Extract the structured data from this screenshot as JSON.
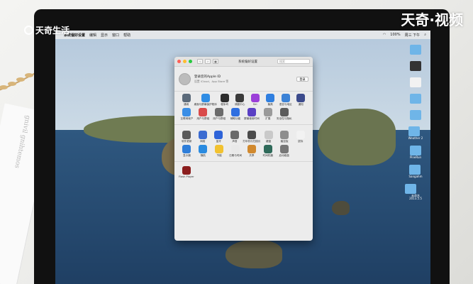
{
  "watermark": {
    "logo_text": "天奇生活",
    "corner_text": "天奇·视频"
  },
  "paper": {
    "text": "gnivil gnihtemos"
  },
  "menubar": {
    "left": [
      "系统偏好设置",
      "编辑",
      "显示",
      "窗口",
      "帮助"
    ],
    "right": [
      "100%",
      "周三 下午"
    ]
  },
  "window": {
    "title": "系统偏好设置",
    "search_placeholder": "搜索",
    "nav_back": "‹",
    "nav_forward": "›",
    "apple_id": {
      "title": "登录您的Apple ID",
      "subtitle": "设置 iCloud、App Store 等",
      "button": "登录"
    },
    "row1": [
      {
        "label": "通用",
        "color": "#5b6a7a"
      },
      {
        "label": "桌面与屏幕保护程序",
        "color": "#2f8de4"
      },
      {
        "label": "程序坞",
        "color": "#2c2c2c"
      },
      {
        "label": "调度中心",
        "color": "#3a3a3a"
      },
      {
        "label": "Siri",
        "color": "#9b3fd8"
      },
      {
        "label": "聚焦",
        "color": "#2f7fe0"
      },
      {
        "label": "语言与地区",
        "color": "#3b82d6"
      },
      {
        "label": "通知",
        "color": "#3c4b8c"
      }
    ],
    "row2": [
      {
        "label": "互联网帐户",
        "color": "#3a8ee6"
      },
      {
        "label": "用户与群组",
        "color": "#d94a4a"
      },
      {
        "label": "用户与群组",
        "color": "#6b6b6b"
      },
      {
        "label": "辅助功能",
        "color": "#2f6fe0"
      },
      {
        "label": "屏幕使用时间",
        "color": "#5a3fc4"
      },
      {
        "label": "扩展",
        "color": "#9a9a9a"
      },
      {
        "label": "安全性与隐私",
        "color": "#5c5c5c"
      }
    ],
    "row3": [
      {
        "label": "软件更新",
        "color": "#5a5a5a"
      },
      {
        "label": "网络",
        "color": "#3b6bd1"
      },
      {
        "label": "蓝牙",
        "color": "#2e63d8"
      },
      {
        "label": "声音",
        "color": "#6a6a6a"
      },
      {
        "label": "打印机与扫描仪",
        "color": "#4b4b4b"
      },
      {
        "label": "键盘",
        "color": "#c9c9c9"
      },
      {
        "label": "触控板",
        "color": "#8e8e8e"
      },
      {
        "label": "鼠标",
        "color": "#f2f2f2"
      }
    ],
    "row4": [
      {
        "label": "显示器",
        "color": "#2f7ed9"
      },
      {
        "label": "随航",
        "color": "#2a8be0"
      },
      {
        "label": "节能",
        "color": "#f2c230"
      },
      {
        "label": "日期与时间",
        "color": "#e9e9e9"
      },
      {
        "label": "共享",
        "color": "#d1892e"
      },
      {
        "label": "时间机器",
        "color": "#2f6a5a"
      },
      {
        "label": "启动磁盘",
        "color": "#777777"
      }
    ],
    "flash": {
      "label": "Flash Player",
      "color": "#8b1e1e"
    }
  },
  "desktop_icons": [
    {
      "label": "",
      "color": "#6fb5e8"
    },
    {
      "label": "",
      "color": "#333333"
    },
    {
      "label": "",
      "color": "#f2f2f2"
    },
    {
      "label": "",
      "color": "#6fb5e8"
    },
    {
      "label": "",
      "color": "#6fb5e8"
    },
    {
      "label": "Weather 2",
      "color": "#6fb5e8"
    },
    {
      "label": "PineRun",
      "color": "#6fb5e8"
    },
    {
      "label": "Sangahm",
      "color": "#6fb5e8"
    },
    {
      "label": "未命名 2013.5.5",
      "color": "#6fb5e8"
    }
  ]
}
